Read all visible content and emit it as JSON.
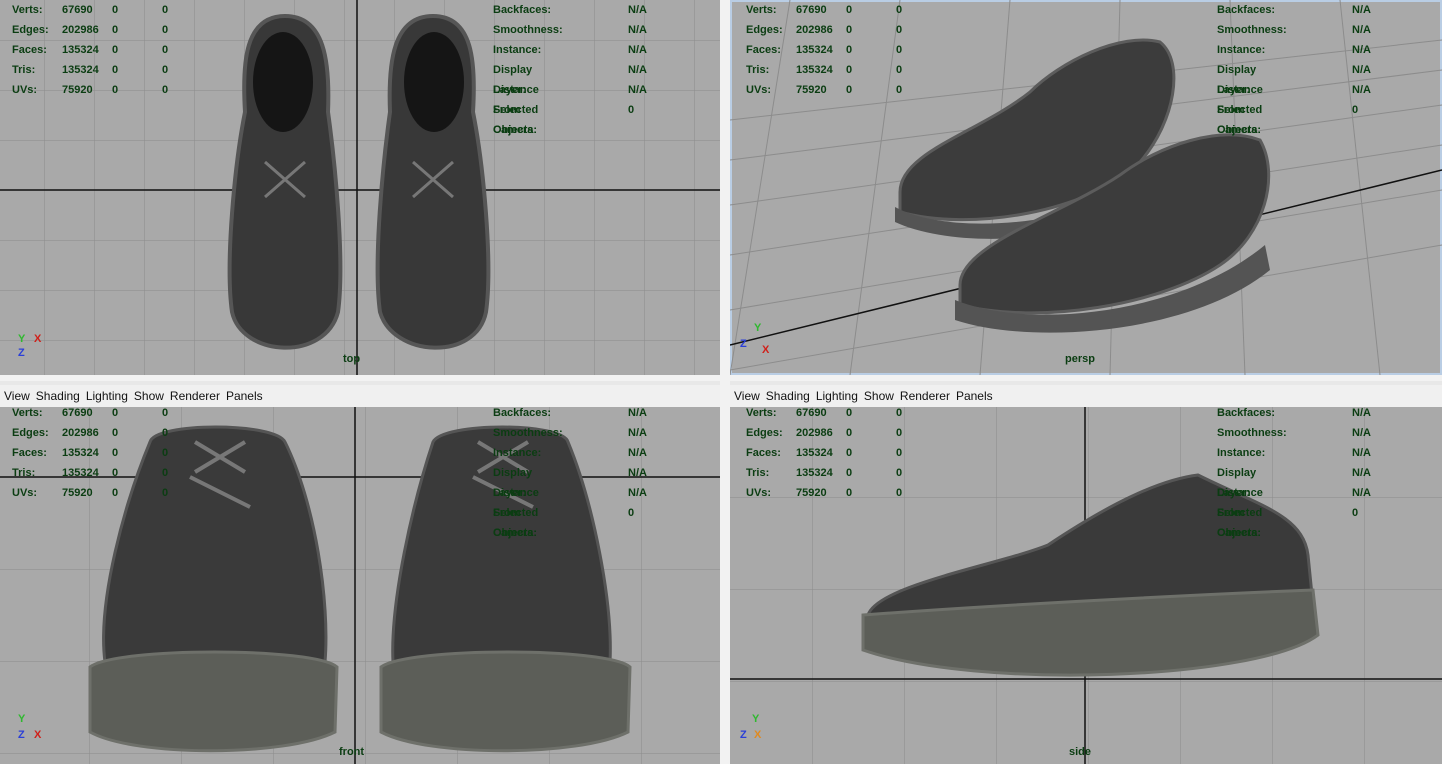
{
  "menu": [
    "View",
    "Shading",
    "Lighting",
    "Show",
    "Renderer",
    "Panels"
  ],
  "stats": [
    {
      "label": "Verts:",
      "v1": "67690",
      "v2": "0",
      "v3": "0"
    },
    {
      "label": "Edges:",
      "v1": "202986",
      "v2": "0",
      "v3": "0"
    },
    {
      "label": "Faces:",
      "v1": "135324",
      "v2": "0",
      "v3": "0"
    },
    {
      "label": "Tris:",
      "v1": "135324",
      "v2": "0",
      "v3": "0"
    },
    {
      "label": "UVs:",
      "v1": "75920",
      "v2": "0",
      "v3": "0"
    }
  ],
  "info": [
    {
      "label": "Backfaces:",
      "value": "N/A"
    },
    {
      "label": "Smoothness:",
      "value": "N/A"
    },
    {
      "label": "Instance:",
      "value": "N/A"
    },
    {
      "label": "Display Layer:",
      "value": "N/A"
    },
    {
      "label": "Distance From Camera:",
      "value": "N/A"
    },
    {
      "label": "Selected Objects:",
      "value": "0"
    }
  ],
  "viewports": {
    "top": {
      "camera": "top"
    },
    "persp": {
      "camera": "persp"
    },
    "front": {
      "camera": "front"
    },
    "side": {
      "camera": "side"
    }
  },
  "axes": {
    "x": "X",
    "y": "Y",
    "z": "Z"
  },
  "colors": {
    "viewport_bg": "#a9a9a9",
    "hud_text": "#0b3d12",
    "axis_x": "#d0201a",
    "axis_y": "#2fb82f",
    "axis_z": "#2a3fd8",
    "active_border": "#b9cde4"
  }
}
